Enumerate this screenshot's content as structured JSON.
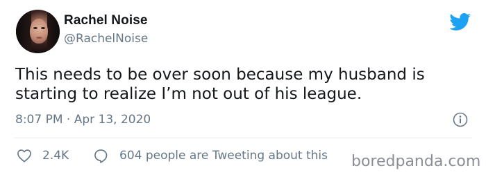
{
  "author": {
    "name": "Rachel Noise",
    "handle": "@RachelNoise"
  },
  "tweet": {
    "text": "This needs to be over soon because my husband is starting to realize I’m not out of his league.",
    "timestamp": "8:07 PM · Apr 13, 2020"
  },
  "engagement": {
    "likes": "2.4K",
    "tweeting_text": "604 people are Tweeting about this"
  },
  "watermark": "boredpanda.com",
  "icons": {
    "brand": "twitter-bird-icon",
    "info": "info-icon",
    "like": "heart-icon",
    "reply": "speech-bubble-icon"
  },
  "colors": {
    "brand": "#1da1f2",
    "text": "#14171a",
    "secondary": "#657786"
  }
}
